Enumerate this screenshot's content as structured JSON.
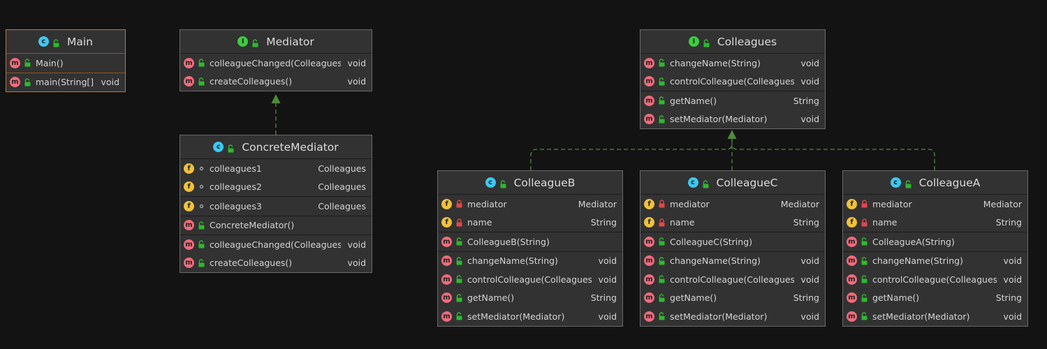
{
  "colors": {
    "background": "#131313",
    "box": "#323232",
    "box_border": "#6a6a6a",
    "selected_border": "#c8742a",
    "class_icon": "#3ec8f0",
    "interface_icon": "#3ccd3c",
    "method_icon": "#f06b7c",
    "field_icon": "#f0c23a",
    "edge": "#4f8a3a"
  },
  "icons": {
    "class": "c",
    "interface": "I",
    "method": "m",
    "field": "f",
    "public": "unlocked-lock-icon",
    "private": "locked-lock-icon",
    "package": "package-private-icon"
  },
  "main": {
    "title": "Main",
    "sections": [
      [
        {
          "name": "Main()",
          "type": ""
        }
      ],
      [
        {
          "name": "main(String[])",
          "type": "void"
        }
      ]
    ]
  },
  "mediator": {
    "title": "Mediator",
    "methods": [
      {
        "name": "colleagueChanged(Colleagues)",
        "type": "void"
      },
      {
        "name": "createColleagues()",
        "type": "void"
      }
    ]
  },
  "concrete_mediator": {
    "title": "ConcreteMediator",
    "fields": [
      {
        "name": "colleagues1",
        "type": "Colleagues"
      },
      {
        "name": "colleagues2",
        "type": "Colleagues"
      },
      {
        "name": "colleagues3",
        "type": "Colleagues"
      }
    ],
    "constructor": {
      "name": "ConcreteMediator()",
      "type": ""
    },
    "methods": [
      {
        "name": "colleagueChanged(Colleagues)",
        "type": "void"
      },
      {
        "name": "createColleagues()",
        "type": "void"
      }
    ]
  },
  "colleagues": {
    "title": "Colleagues",
    "methods_a": [
      {
        "name": "changeName(String)",
        "type": "void"
      },
      {
        "name": "controlColleague(Colleagues)",
        "type": "void"
      }
    ],
    "methods_b": [
      {
        "name": "getName()",
        "type": "String"
      },
      {
        "name": "setMediator(Mediator)",
        "type": "void"
      }
    ]
  },
  "colleague_b": {
    "title": "ColleagueB",
    "fields": [
      {
        "name": "mediator",
        "type": "Mediator"
      },
      {
        "name": "name",
        "type": "String"
      }
    ],
    "constructor": {
      "name": "ColleagueB(String)",
      "type": ""
    },
    "methods": [
      {
        "name": "changeName(String)",
        "type": "void"
      },
      {
        "name": "controlColleague(Colleagues)",
        "type": "void"
      },
      {
        "name": "getName()",
        "type": "String"
      },
      {
        "name": "setMediator(Mediator)",
        "type": "void"
      }
    ]
  },
  "colleague_c": {
    "title": "ColleagueC",
    "fields": [
      {
        "name": "mediator",
        "type": "Mediator"
      },
      {
        "name": "name",
        "type": "String"
      }
    ],
    "constructor": {
      "name": "ColleagueC(String)",
      "type": ""
    },
    "methods": [
      {
        "name": "changeName(String)",
        "type": "void"
      },
      {
        "name": "controlColleague(Colleagues)",
        "type": "void"
      },
      {
        "name": "getName()",
        "type": "String"
      },
      {
        "name": "setMediator(Mediator)",
        "type": "void"
      }
    ]
  },
  "colleague_a": {
    "title": "ColleagueA",
    "fields": [
      {
        "name": "mediator",
        "type": "Mediator"
      },
      {
        "name": "name",
        "type": "String"
      }
    ],
    "constructor": {
      "name": "ColleagueA(String)",
      "type": ""
    },
    "methods": [
      {
        "name": "changeName(String)",
        "type": "void"
      },
      {
        "name": "controlColleague(Colleagues)",
        "type": "void"
      },
      {
        "name": "getName()",
        "type": "String"
      },
      {
        "name": "setMediator(Mediator)",
        "type": "void"
      }
    ]
  }
}
